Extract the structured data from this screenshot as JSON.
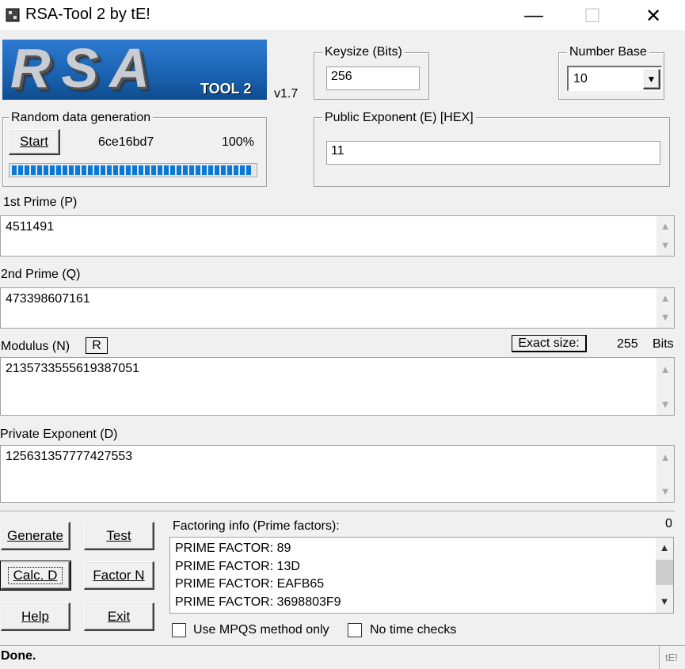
{
  "window": {
    "title": "RSA-Tool 2 by tE!",
    "controls": {
      "minimize": "—",
      "maximize": "☐",
      "close": "✕"
    }
  },
  "logo": {
    "main": "RSA",
    "sub": "TOOL 2",
    "version": "v1.7"
  },
  "keysize": {
    "label": "Keysize (Bits)",
    "value": "256"
  },
  "number_base": {
    "label": "Number Base",
    "value": "10"
  },
  "random": {
    "label": "Random data generation",
    "start_button": "Start",
    "hash": "6ce16bd7",
    "percent": "100%",
    "progress": 1.0
  },
  "public_exponent": {
    "label": "Public Exponent (E) [HEX]",
    "value": "11"
  },
  "prime_p": {
    "label": "1st Prime (P)",
    "value": "4511491"
  },
  "prime_q": {
    "label": "2nd Prime (Q)",
    "value": "473398607161"
  },
  "modulus": {
    "label": "Modulus (N)",
    "r_button": "R",
    "exact_size_label": "Exact size:",
    "exact_size_value": "255",
    "bits_label": "Bits",
    "value": "2135733555619387051"
  },
  "private_exponent": {
    "label": "Private Exponent (D)",
    "value": "125631357777427553"
  },
  "buttons": {
    "generate": "Generate",
    "test": "Test",
    "calc_d": "Calc. D",
    "factor_n": "Factor N",
    "help": "Help",
    "exit": "Exit"
  },
  "factoring": {
    "label": "Factoring info (Prime factors):",
    "count": "0",
    "lines": [
      "PRIME FACTOR: 89",
      "PRIME FACTOR: 13D",
      "PRIME FACTOR: EAFB65",
      "PRIME FACTOR: 3698803F9"
    ]
  },
  "options": {
    "mpqs": "Use MPQS method only",
    "no_time": "No time checks"
  },
  "status": {
    "text": "Done.",
    "tag": "tE!"
  },
  "colors": {
    "progress": "#0a78d7",
    "logo_bg": "#1a62b0"
  }
}
